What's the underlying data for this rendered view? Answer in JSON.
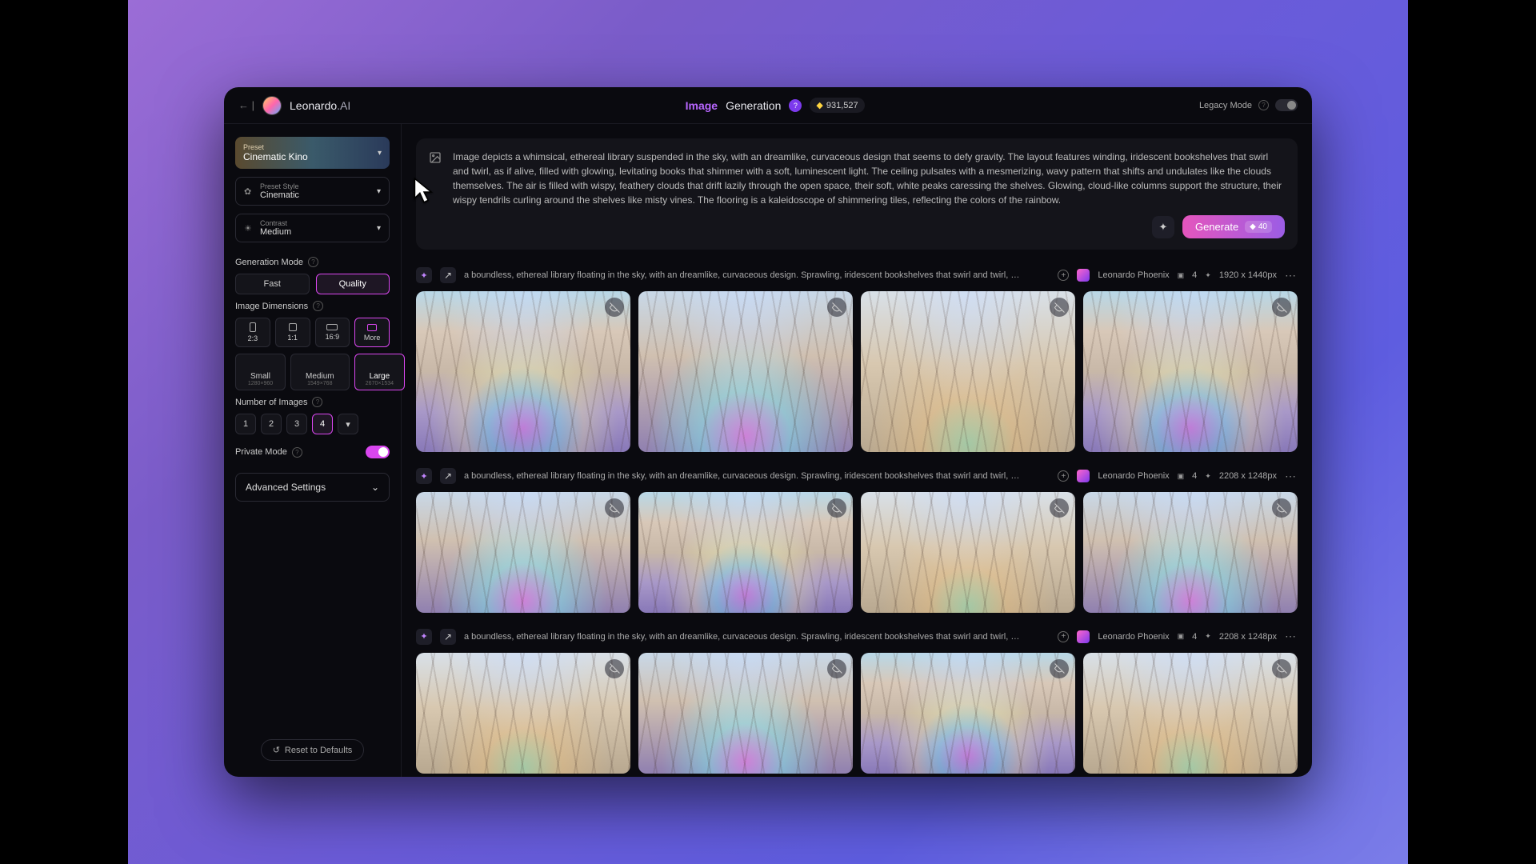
{
  "header": {
    "brand_name": "Leonardo",
    "brand_suffix": ".AI",
    "title_prefix": "Image",
    "title_suffix": "Generation",
    "credits": "931,527",
    "legacy_label": "Legacy Mode"
  },
  "sidebar": {
    "preset": {
      "label": "Preset",
      "value": "Cinematic Kino"
    },
    "preset_style": {
      "label": "Preset Style",
      "value": "Cinematic"
    },
    "contrast": {
      "label": "Contrast",
      "value": "Medium"
    },
    "gen_mode": {
      "label": "Generation Mode",
      "options": [
        "Fast",
        "Quality"
      ],
      "selected": "Quality"
    },
    "dimensions": {
      "label": "Image Dimensions",
      "ratios": [
        "2:3",
        "1:1",
        "16:9",
        "More"
      ],
      "ratio_selected": "More",
      "sizes": [
        {
          "name": "Small",
          "px": "1280×960"
        },
        {
          "name": "Medium",
          "px": "1549×768"
        },
        {
          "name": "Large",
          "px": "2670×1534"
        }
      ],
      "size_selected": "Large"
    },
    "num_images": {
      "label": "Number of Images",
      "options": [
        "1",
        "2",
        "3",
        "4"
      ],
      "selected": "4"
    },
    "private": {
      "label": "Private Mode",
      "on": true
    },
    "advanced": "Advanced Settings",
    "reset": "Reset to Defaults"
  },
  "prompt": {
    "text": "Image depicts a whimsical, ethereal library suspended in the sky, with an dreamlike, curvaceous design that seems to defy gravity. The layout features winding, iridescent bookshelves that swirl and twirl, as if alive, filled with glowing, levitating books that shimmer with a soft, luminescent light. The ceiling pulsates with a mesmerizing, wavy pattern that shifts and undulates like the clouds themselves. The air is filled with wispy, feathery clouds that drift lazily through the open space, their soft, white peaks caressing the shelves. Glowing, cloud-like columns support the structure, their wispy tendrils curling around the shelves like misty vines. The flooring is a kaleidoscope of shimmering tiles, reflecting the colors of the rainbow.",
    "generate_label": "Generate",
    "generate_cost": "40"
  },
  "generations": [
    {
      "prompt_preview": "a boundless, ethereal library floating in the sky, with an dreamlike, curvaceous design. Sprawling, iridescent bookshelves that swirl and twirl, …",
      "model": "Leonardo Phoenix",
      "count": "4",
      "resolution": "1920 x 1440px"
    },
    {
      "prompt_preview": "a boundless, ethereal library floating in the sky, with an dreamlike, curvaceous design. Sprawling, iridescent bookshelves that swirl and twirl, …",
      "model": "Leonardo Phoenix",
      "count": "4",
      "resolution": "2208 x 1248px"
    },
    {
      "prompt_preview": "a boundless, ethereal library floating in the sky, with an dreamlike, curvaceous design. Sprawling, iridescent bookshelves that swirl and twirl, …",
      "model": "Leonardo Phoenix",
      "count": "4",
      "resolution": "2208 x 1248px"
    }
  ]
}
